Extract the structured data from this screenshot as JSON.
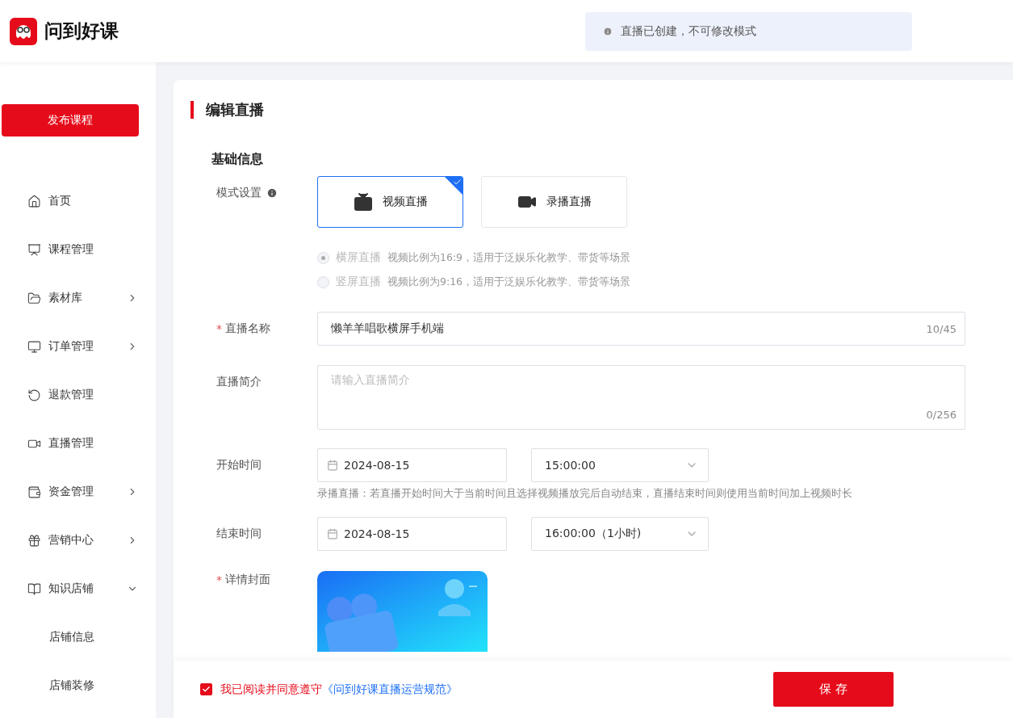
{
  "header": {
    "logo_text": "问到好课",
    "notice": "直播已创建，不可修改模式"
  },
  "sidebar": {
    "publish_button": "发布课程",
    "items": [
      {
        "label": "首页",
        "kind": "link"
      },
      {
        "label": "课程管理",
        "kind": "link"
      },
      {
        "label": "素材库",
        "kind": "group",
        "expanded": false
      },
      {
        "label": "订单管理",
        "kind": "group",
        "expanded": false
      },
      {
        "label": "退款管理",
        "kind": "link"
      },
      {
        "label": "直播管理",
        "kind": "link"
      },
      {
        "label": "资金管理",
        "kind": "group",
        "expanded": false
      },
      {
        "label": "营销中心",
        "kind": "group",
        "expanded": false
      },
      {
        "label": "知识店铺",
        "kind": "group",
        "expanded": true,
        "children": [
          {
            "label": "店铺信息"
          },
          {
            "label": "店铺装修"
          }
        ]
      }
    ]
  },
  "page_title": "编辑直播",
  "section_title": "基础信息",
  "mode": {
    "label": "模式设置",
    "options": [
      {
        "label": "视频直播",
        "selected": true
      },
      {
        "label": "录播直播",
        "selected": false
      }
    ],
    "orientations": [
      {
        "label": "横屏直播",
        "description": "视频比例为16:9，适用于泛娱乐化教学、带货等场景",
        "selected": true,
        "disabled": true
      },
      {
        "label": "竖屏直播",
        "description": "视频比例为9:16，适用于泛娱乐化教学、带货等场景",
        "selected": false,
        "disabled": true
      }
    ]
  },
  "name_field": {
    "label": "直播名称",
    "required_mark": "*",
    "value": "懒羊羊唱歌横屏手机端",
    "counter": "10/45"
  },
  "intro_field": {
    "label": "直播简介",
    "placeholder": "请输入直播简介",
    "counter": "0/256"
  },
  "start_time": {
    "label": "开始时间",
    "date": "2024-08-15",
    "time": "15:00:00",
    "hint": "录播直播：若直播开始时间大于当前时间且选择视频播放完后自动结束，直播结束时间则使用当前时间加上视频时长"
  },
  "end_time": {
    "label": "结束时间",
    "date": "2024-08-15",
    "time": "16:00:00（1小时)"
  },
  "cover": {
    "label": "详情封面",
    "required_mark": "*",
    "kind": "picture"
  },
  "footer": {
    "agree_checked": true,
    "agree_text": "我已阅读并同意遵守",
    "agree_link": "《问到好课直播运营规范》",
    "save_button": "保 存"
  }
}
